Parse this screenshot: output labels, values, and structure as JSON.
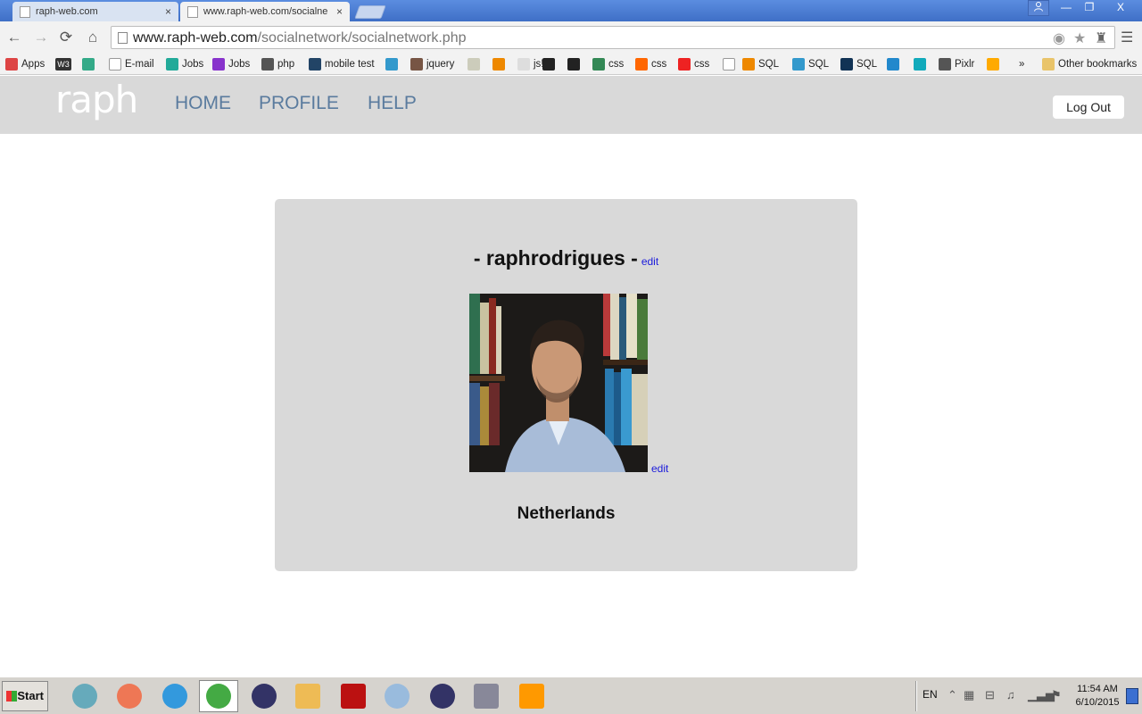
{
  "browser": {
    "tabs": [
      {
        "label": "raph-web.com",
        "close": "×"
      },
      {
        "label": "www.raph-web.com/socialne",
        "close": "×"
      }
    ],
    "window_buttons": {
      "minimize": "—",
      "maximize": "❐",
      "close": "X"
    },
    "url_host": "www.raph-web.com",
    "url_path": "/socialnetwork/socialnetwork.php",
    "nav": {
      "back": "←",
      "forward": "→",
      "reload": "⟳",
      "home": "⌂"
    },
    "bookmarks": [
      {
        "label": "Apps",
        "color": "#d44"
      },
      {
        "label": "",
        "color": "#333",
        "text": "W3"
      },
      {
        "label": "",
        "color": "#3a8"
      },
      {
        "label": "E-mail",
        "color": "#fff"
      },
      {
        "label": "Jobs",
        "color": "#2a9"
      },
      {
        "label": "Jobs",
        "color": "#83c"
      },
      {
        "label": "php",
        "color": "#555"
      },
      {
        "label": "mobile test",
        "color": "#246"
      },
      {
        "label": "",
        "color": "#39c"
      },
      {
        "label": "jquery",
        "color": "#754"
      },
      {
        "label": "",
        "color": "#ccb"
      },
      {
        "label": "",
        "color": "#e80"
      },
      {
        "label": "js!",
        "color": "#ddd"
      },
      {
        "label": "",
        "color": "#222"
      },
      {
        "label": "",
        "color": "#222"
      },
      {
        "label": "css",
        "color": "#385"
      },
      {
        "label": "css",
        "color": "#f60"
      },
      {
        "label": "css",
        "color": "#e22"
      },
      {
        "label": "",
        "color": "#fff"
      },
      {
        "label": "SQL",
        "color": "#e80"
      },
      {
        "label": "SQL",
        "color": "#39c"
      },
      {
        "label": "SQL",
        "color": "#135"
      },
      {
        "label": "",
        "color": "#28c"
      },
      {
        "label": "",
        "color": "#1ab"
      },
      {
        "label": "Pixlr",
        "color": "#555"
      },
      {
        "label": "",
        "color": "#fa0"
      },
      {
        "label": "»",
        "color": ""
      },
      {
        "label": "Other bookmarks",
        "color": "#e9c46a"
      }
    ]
  },
  "site": {
    "logo": "raph",
    "nav": {
      "home": "HOME",
      "profile": "PROFILE",
      "help": "HELP"
    },
    "logout": "Log Out"
  },
  "profile": {
    "username": "- raphrodrigues -",
    "edit_name": "edit",
    "edit_photo": "edit",
    "country": "Netherlands"
  },
  "taskbar": {
    "start": "Start",
    "apps": [
      {
        "name": "safari",
        "color": "#6ab"
      },
      {
        "name": "firefox",
        "color": "#e75"
      },
      {
        "name": "ie",
        "color": "#39d"
      },
      {
        "name": "chrome",
        "color": "#4a4"
      },
      {
        "name": "eclipse",
        "color": "#336"
      },
      {
        "name": "explorer",
        "color": "#eb5"
      },
      {
        "name": "filezilla",
        "color": "#b11"
      },
      {
        "name": "paint",
        "color": "#9bd"
      },
      {
        "name": "eclipse-2",
        "color": "#336"
      },
      {
        "name": "archive",
        "color": "#889"
      },
      {
        "name": "settings",
        "color": "#f90"
      }
    ],
    "lang": "EN",
    "time": "11:54 AM",
    "date": "6/10/2015"
  },
  "colors": {
    "header_bg": "#d9d9d9",
    "nav_link": "#5a7b9e",
    "edit_link": "#1a1adb"
  }
}
